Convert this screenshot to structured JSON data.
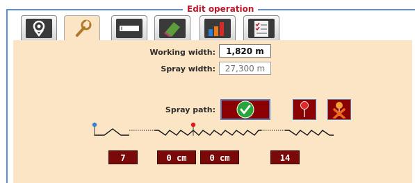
{
  "window": {
    "title": "Edit operation"
  },
  "tabs": [
    {
      "name": "location",
      "icon": "map-pin-icon"
    },
    {
      "name": "settings",
      "icon": "wrench-icon",
      "active": true
    },
    {
      "name": "input",
      "icon": "text-field-icon"
    },
    {
      "name": "eraser",
      "icon": "eraser-icon"
    },
    {
      "name": "chart",
      "icon": "bar-chart-icon"
    },
    {
      "name": "checklist",
      "icon": "checklist-icon"
    }
  ],
  "working_width": {
    "label": "Working width:",
    "value": "1,820 m"
  },
  "spray_width": {
    "label": "Spray width:",
    "value": "27,300 m"
  },
  "spray_path": {
    "label": "Spray path:"
  },
  "counters": {
    "start": "7",
    "offset_left": "0 cm",
    "offset_right": "0 cm",
    "end": "14"
  },
  "colors": {
    "accent": "#5b8fd6",
    "title": "#c0162a",
    "panel": "#fbe5c4",
    "button": "#8b0000"
  }
}
